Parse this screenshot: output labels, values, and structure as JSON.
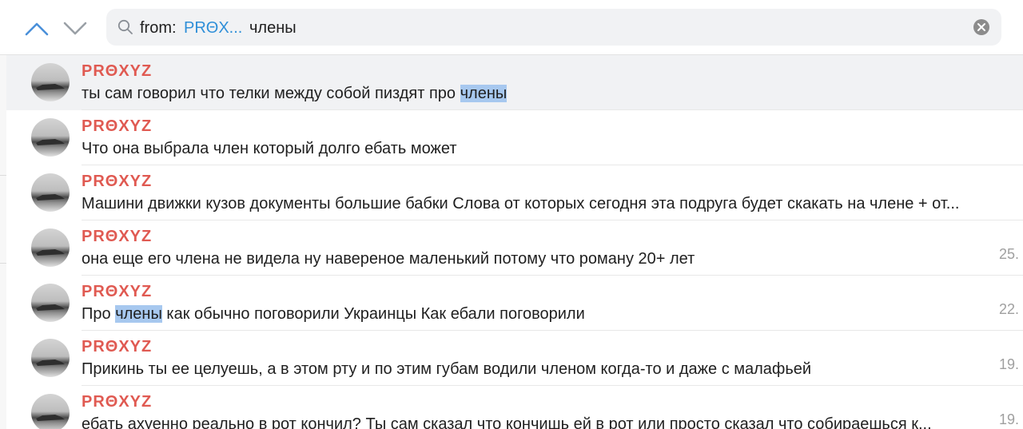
{
  "search": {
    "from_label": "from:",
    "from_chip": "PRΘX...",
    "query": "члены"
  },
  "results": [
    {
      "sender": "PRΘXYZ",
      "pre": "ты сам говорил что телки между собой пиздят про ",
      "hl": "члены",
      "post": "",
      "date": ""
    },
    {
      "sender": "PRΘXYZ",
      "pre": "Что она выбрала член который долго ебать может",
      "hl": "",
      "post": "",
      "date": ""
    },
    {
      "sender": "PRΘXYZ",
      "pre": "Машини движки кузов документы большие бабки Слова от которых сегодня эта подруга будет скакать на члене + от...",
      "hl": "",
      "post": "",
      "date": ""
    },
    {
      "sender": "PRΘXYZ",
      "pre": "она еще его члена не видела ну навереное маленький потому что роману 20+ лет",
      "hl": "",
      "post": "",
      "date": "25."
    },
    {
      "sender": "PRΘXYZ",
      "pre": "Про ",
      "hl": "члены",
      "post": " как обычно поговорили Украинцы Как ебали поговорили",
      "date": "22."
    },
    {
      "sender": "PRΘXYZ",
      "pre": "Прикинь ты ее целуешь, а в этом рту и по этим губам водили членом когда-то и даже с малафьей",
      "hl": "",
      "post": "",
      "date": "19."
    },
    {
      "sender": "PRΘXYZ",
      "pre": "ебать ахуенно реально в рот кончил? Ты сам сказал что кончишь ей в рот или просто сказал что собираешься к...",
      "hl": "",
      "post": "",
      "date": "19."
    }
  ]
}
